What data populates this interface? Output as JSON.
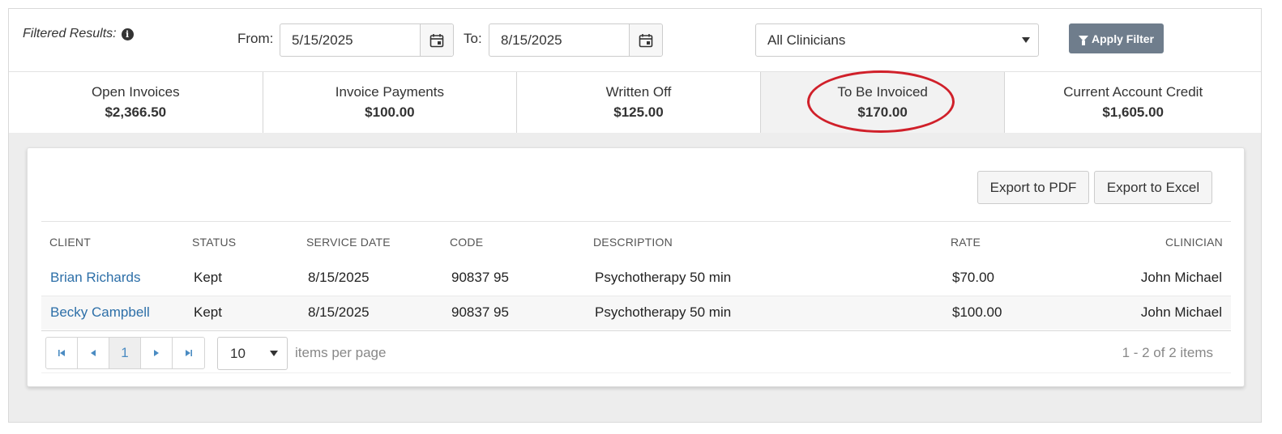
{
  "filter": {
    "label": "Filtered Results:",
    "from_label": "From:",
    "from_value": "5/15/2025",
    "to_label": "To:",
    "to_value": "8/15/2025",
    "clinician_value": "All Clinicians",
    "apply_label": "Apply Filter"
  },
  "summary": [
    {
      "title": "Open Invoices",
      "value": "$2,366.50"
    },
    {
      "title": "Invoice Payments",
      "value": "$100.00"
    },
    {
      "title": "Written Off",
      "value": "$125.00"
    },
    {
      "title": "To Be Invoiced",
      "value": "$170.00"
    },
    {
      "title": "Current Account Credit",
      "value": "$1,605.00"
    }
  ],
  "toolbar": {
    "export_pdf": "Export to PDF",
    "export_excel": "Export to Excel"
  },
  "table": {
    "headers": [
      "CLIENT",
      "STATUS",
      "SERVICE DATE",
      "CODE",
      "DESCRIPTION",
      "RATE",
      "CLINICIAN"
    ],
    "rows": [
      {
        "client": "Brian Richards",
        "status": "Kept",
        "date": "8/15/2025",
        "code": "90837 95",
        "description": "Psychotherapy 50 min",
        "rate": "$70.00",
        "clinician": "John Michael"
      },
      {
        "client": "Becky Campbell",
        "status": "Kept",
        "date": "8/15/2025",
        "code": "90837 95",
        "description": "Psychotherapy 50 min",
        "rate": "$100.00",
        "clinician": "John Michael"
      }
    ]
  },
  "pager": {
    "current_page": "1",
    "page_size": "10",
    "items_per_page_label": "items per page",
    "count_text": "1 - 2 of 2 items"
  },
  "colors": {
    "link": "#2d6fa8",
    "apply_button": "#6f7d8c",
    "highlight_circle": "#d0202a"
  }
}
